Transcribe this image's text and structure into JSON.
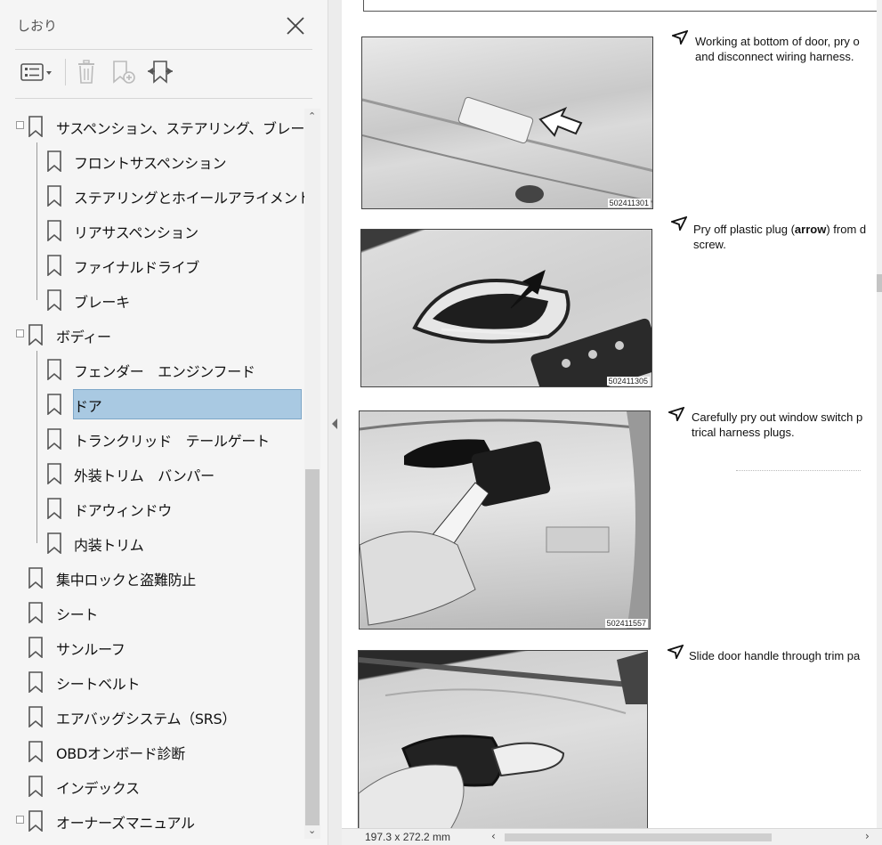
{
  "sidebar": {
    "title": "しおり",
    "toolbar": {
      "options": "list-options-icon",
      "delete": "trash-icon",
      "new_bookmark": "new-bookmark-icon",
      "expand": "expand-bookmark-icon"
    },
    "items": [
      {
        "label": "サスペンション、ステアリング、ブレーキ全般",
        "level": 0,
        "expanded": true
      },
      {
        "label": "フロントサスペンション",
        "level": 1
      },
      {
        "label": "ステアリングとホイールアライメント",
        "level": 1
      },
      {
        "label": "リアサスペンション",
        "level": 1
      },
      {
        "label": "ファイナルドライブ",
        "level": 1
      },
      {
        "label": "ブレーキ",
        "level": 1
      },
      {
        "label": "ボディー",
        "level": 0,
        "expanded": true
      },
      {
        "label": "フェンダー　エンジンフード",
        "level": 1
      },
      {
        "label": "ドア",
        "level": 1,
        "selected": true
      },
      {
        "label": "トランクリッド　テールゲート",
        "level": 1
      },
      {
        "label": "外装トリム　バンパー",
        "level": 1
      },
      {
        "label": "ドアウィンドウ",
        "level": 1
      },
      {
        "label": "内装トリム",
        "level": 1
      },
      {
        "label": "集中ロックと盗難防止",
        "level": 0
      },
      {
        "label": "シート",
        "level": 0
      },
      {
        "label": "サンルーフ",
        "level": 0
      },
      {
        "label": "シートベルト",
        "level": 0
      },
      {
        "label": "エアバッグシステム（SRS）",
        "level": 0
      },
      {
        "label": "OBDオンボード診断",
        "level": 0
      },
      {
        "label": "インデックス",
        "level": 0
      },
      {
        "label": "オーナーズマニュアル",
        "level": 0,
        "expanded": true
      }
    ]
  },
  "document": {
    "steps": [
      {
        "line1": "Working at bottom of door, pry o",
        "line2": "and disconnect wiring harness.",
        "fig": "502411301"
      },
      {
        "line1a": "Pry off plastic plug (",
        "line1b": "arrow",
        "line1c": ") from d",
        "line2": "screw.",
        "fig": "502411305"
      },
      {
        "line1": "Carefully pry out window switch p",
        "line2": "trical harness plugs.",
        "fig": "502411557"
      },
      {
        "line1": "Slide door handle through trim pa",
        "line2": "",
        "fig": ""
      }
    ]
  },
  "status": {
    "page_size": "197.3 x 272.2 mm"
  }
}
